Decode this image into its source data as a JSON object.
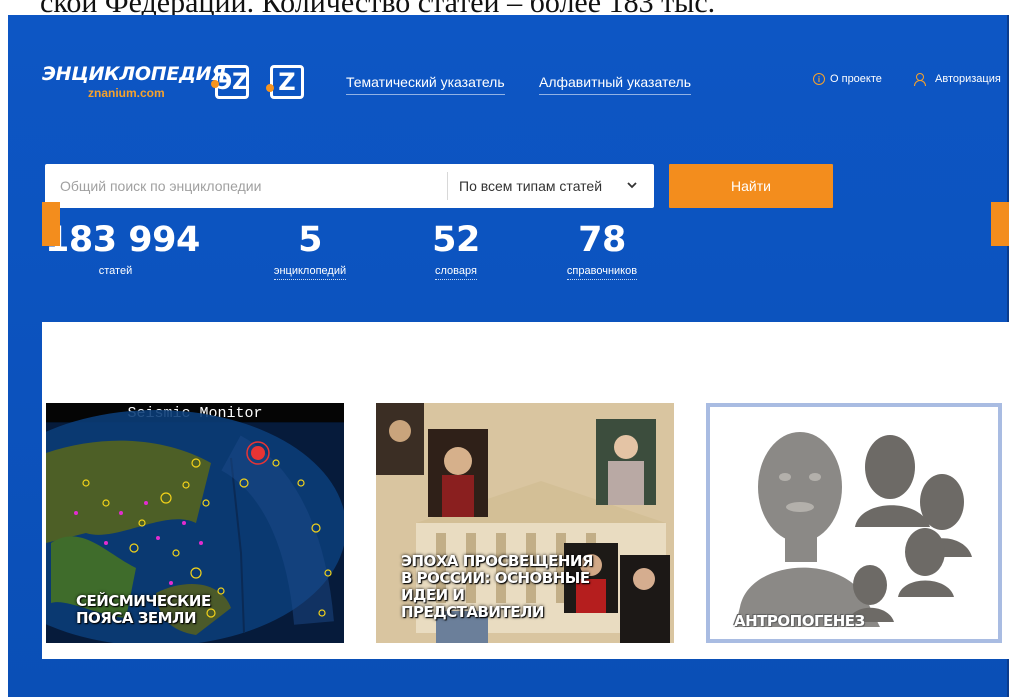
{
  "document_overflow_text": "ской Федерации. Количество статей – более 183 тыс.",
  "logo": {
    "word": "ЭНЦИКЛОПЕДИЯ",
    "sub": "znanium.com",
    "ez": "ЭZ",
    "z": "Z"
  },
  "nav": {
    "topics": "Тематический указатель",
    "alpha": "Алфавитный указатель"
  },
  "top_links": {
    "about": "О проекте",
    "auth": "Авторизация"
  },
  "search": {
    "placeholder": "Общий поиск по энциклопедии",
    "value": "",
    "type_selected": "По всем типам статей",
    "button": "Найти"
  },
  "stats": [
    {
      "number": "183 994",
      "label": "статей"
    },
    {
      "number": "5",
      "label": "энциклопедий"
    },
    {
      "number": "52",
      "label": "словаря"
    },
    {
      "number": "78",
      "label": "справочников"
    }
  ],
  "cards": [
    {
      "title_top": "Seismic Monitor",
      "label": "СЕЙСМИЧЕСКИЕ ПОЯСА ЗЕМЛИ"
    },
    {
      "label": "ЭПОХА ПРОСВЕЩЕНИЯ В РОССИИ: ОСНОВНЫЕ ИДЕИ И ПРЕДСТАВИТЕЛИ"
    },
    {
      "label": "АНТРОПОГЕНЕЗ"
    }
  ],
  "colors": {
    "background": "#0c52bd",
    "accent": "#f38d1d",
    "panel": "#ffffff"
  }
}
